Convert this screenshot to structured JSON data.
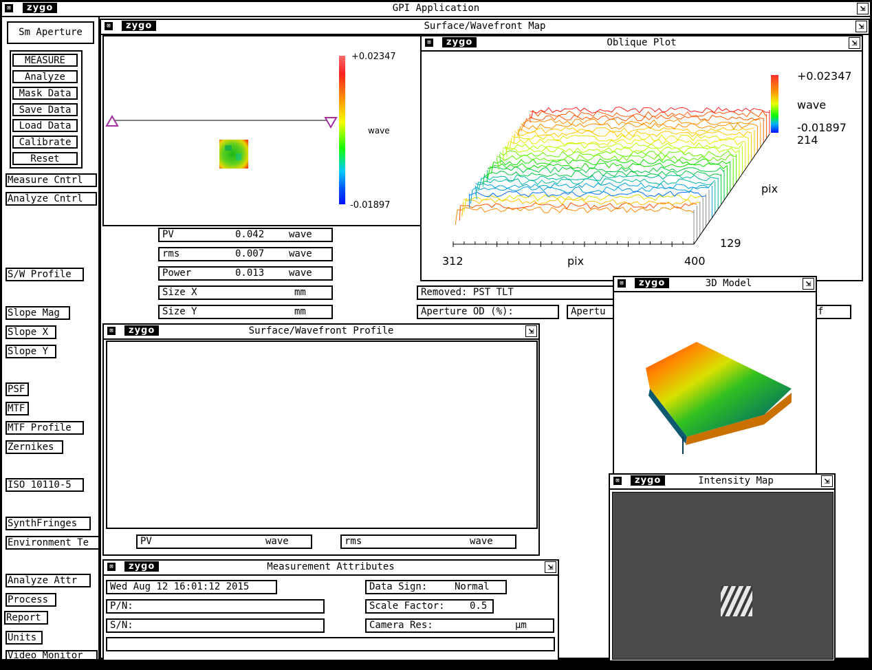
{
  "app": {
    "title": "GPI Application",
    "logo": "zygo",
    "close_glyph": "⊠",
    "resize_glyph": "⇲"
  },
  "sidebar": {
    "sm_aperture": "Sm Aperture",
    "group": [
      "MEASURE",
      "Analyze",
      "Mask Data",
      "Save Data",
      "Load Data",
      "Calibrate",
      "Reset"
    ],
    "measure_cntrl": "Measure Cntrl",
    "analyze_cntrl": "Analyze Cntrl",
    "sw_profile": "S/W Profile",
    "slope_mag": "Slope Mag",
    "slope_x": "Slope X",
    "slope_y": "Slope Y",
    "psf": "PSF",
    "mtf": "MTF",
    "mtf_profile": "MTF Profile",
    "zernikes": "Zernikes",
    "iso": "ISO 10110-5",
    "synth": "SynthFringes",
    "environment": "Environment Te",
    "analyze_attr": "Analyze Attr",
    "process": "Process",
    "report": "Report",
    "units": "Units",
    "video_monitor": "Video Monitor"
  },
  "surface_map": {
    "title": "Surface/Wavefront Map",
    "scale_max": "+0.02347",
    "scale_min": "-0.01897",
    "unit": "wave"
  },
  "results": {
    "pv_label": "PV",
    "pv_value": "0.042",
    "pv_unit": "wave",
    "rms_label": "rms",
    "rms_value": "0.007",
    "rms_unit": "wave",
    "power_label": "Power",
    "power_value": "0.013",
    "power_unit": "wave",
    "sizex_label": "Size X",
    "sizex_unit": "mm",
    "sizey_label": "Size Y",
    "sizey_unit": "mm"
  },
  "oblique": {
    "title": "Oblique Plot",
    "scale_max": "+0.02347",
    "unit": "wave",
    "scale_min": "-0.01897",
    "y_max": "214",
    "y_label": "pix",
    "y_min": "129",
    "x_min": "312",
    "x_label": "pix",
    "x_max": "400"
  },
  "removed": {
    "removed": "Removed: PST TLT",
    "aperture_od": "Aperture OD (%):",
    "aperture_id": "Apertu",
    "extra_tail": "f"
  },
  "model3d": {
    "title": "3D Model"
  },
  "profile": {
    "title": "Surface/Wavefront Profile",
    "pv_label": "PV",
    "pv_unit": "wave",
    "rms_label": "rms",
    "rms_unit": "wave"
  },
  "intensity": {
    "title": "Intensity Map"
  },
  "attributes": {
    "title": "Measurement Attributes",
    "date": "Wed Aug 12 16:01:12 2015",
    "pn": "P/N:",
    "sn": "S/N:",
    "data_sign_label": "Data Sign:",
    "data_sign_value": "Normal",
    "scale_label": "Scale Factor:",
    "scale_value": "0.5",
    "camera_label": "Camera Res:",
    "camera_unit": "µm"
  }
}
